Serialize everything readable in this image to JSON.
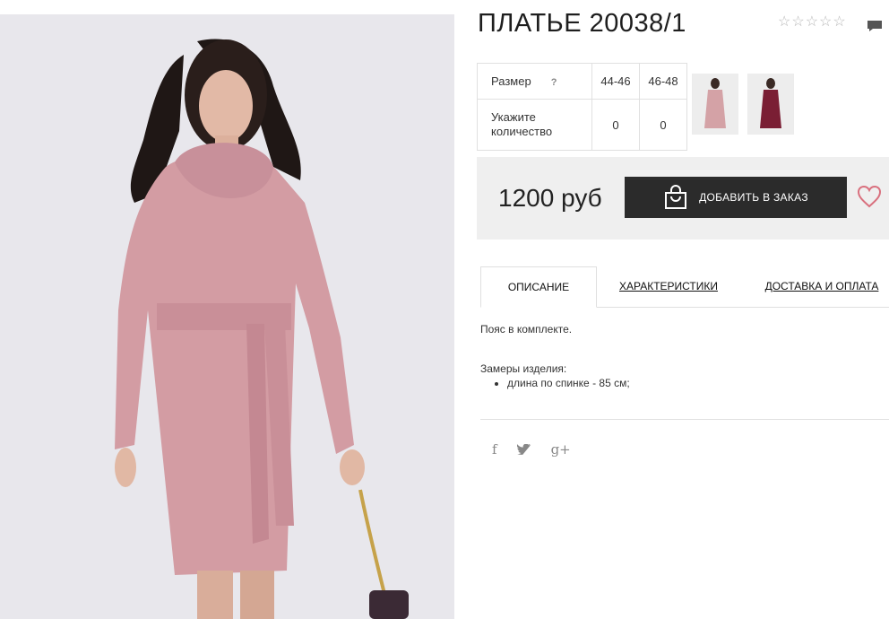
{
  "product": {
    "title": "ПЛАТЬЕ 20038/1"
  },
  "rating": {
    "stars": [
      "☆",
      "☆",
      "☆",
      "☆",
      "☆"
    ],
    "value": 0,
    "max": 5
  },
  "sizes": {
    "label": "Размер",
    "help": "?",
    "columns": [
      "44-46",
      "46-48"
    ],
    "quantity_label_line1": "Укажите",
    "quantity_label_line2": "количество",
    "quantities": [
      "0",
      "0"
    ]
  },
  "colors": [
    {
      "name": "pink-variant",
      "color": "#d4a2a6"
    },
    {
      "name": "burgundy-variant",
      "color": "#7a1e34"
    }
  ],
  "buy": {
    "price": "1200 руб",
    "add_label": "ДОБАВИТЬ В ЗАКАЗ"
  },
  "tabs": [
    {
      "label": "ОПИСАНИЕ"
    },
    {
      "label": "ХАРАКТЕРИСТИКИ"
    },
    {
      "label": "ДОСТАВКА И ОПЛАТА"
    }
  ],
  "description": {
    "line1": "Пояс в комплекте.",
    "line2": "Замеры изделия:",
    "bullets": [
      "длина по спинке - 85 см;"
    ]
  },
  "social": {
    "facebook": "f",
    "twitter": "t",
    "gplus": "g+"
  },
  "colors_theme": {
    "accent_dark": "#2b2b2b",
    "heart": "#d9707e",
    "dress": "#d39ca3"
  }
}
